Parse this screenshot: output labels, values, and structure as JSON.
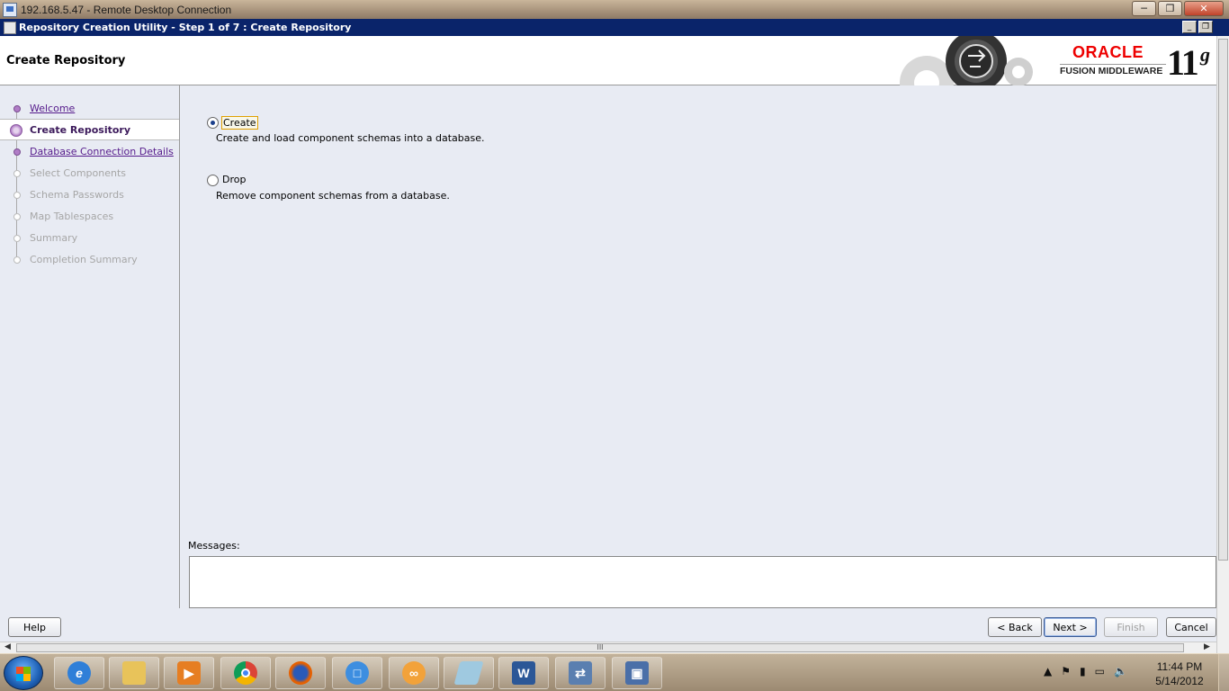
{
  "rdp_window": {
    "title": "192.168.5.47 - Remote Desktop Connection"
  },
  "app_window": {
    "title": "Repository Creation Utility - Step 1 of 7 : Create Repository"
  },
  "header": {
    "title": "Create Repository",
    "brand": "ORACLE",
    "product": "FUSION MIDDLEWARE",
    "version": "11",
    "version_suffix": "g"
  },
  "nav": {
    "items": [
      {
        "label": "Welcome",
        "state": "done"
      },
      {
        "label": "Create Repository",
        "state": "current"
      },
      {
        "label": "Database Connection Details",
        "state": "done"
      },
      {
        "label": "Select Components",
        "state": "todo"
      },
      {
        "label": "Schema Passwords",
        "state": "todo"
      },
      {
        "label": "Map Tablespaces",
        "state": "todo"
      },
      {
        "label": "Summary",
        "state": "todo"
      },
      {
        "label": "Completion Summary",
        "state": "todo"
      }
    ]
  },
  "main": {
    "options": [
      {
        "label": "Create",
        "description": "Create and load component schemas into a database.",
        "selected": true
      },
      {
        "label": "Drop",
        "description": "Remove component schemas from a database.",
        "selected": false
      }
    ],
    "messages_label": "Messages:",
    "messages_text": ""
  },
  "buttons": {
    "help": "Help",
    "back": "< Back",
    "next": "Next >",
    "finish": "Finish",
    "cancel": "Cancel"
  },
  "scrollbar": {
    "grip": "III"
  },
  "taskbar": {
    "apps": [
      "internet-explorer-icon",
      "file-explorer-icon",
      "media-player-icon",
      "chrome-icon",
      "firefox-icon",
      "app-window-icon",
      "app-orange-icon",
      "notepad-icon",
      "word-icon",
      "network-app-icon",
      "remote-desktop-icon"
    ],
    "clock_time": "11:44 PM",
    "clock_date": "5/14/2012"
  },
  "colors": {
    "app_titlebar": "#0a246a",
    "panel_bg": "#e8ebf3",
    "nav_done": "#551a8b",
    "nav_todo": "#a6a6a6",
    "oracle_red": "#ee0000"
  }
}
